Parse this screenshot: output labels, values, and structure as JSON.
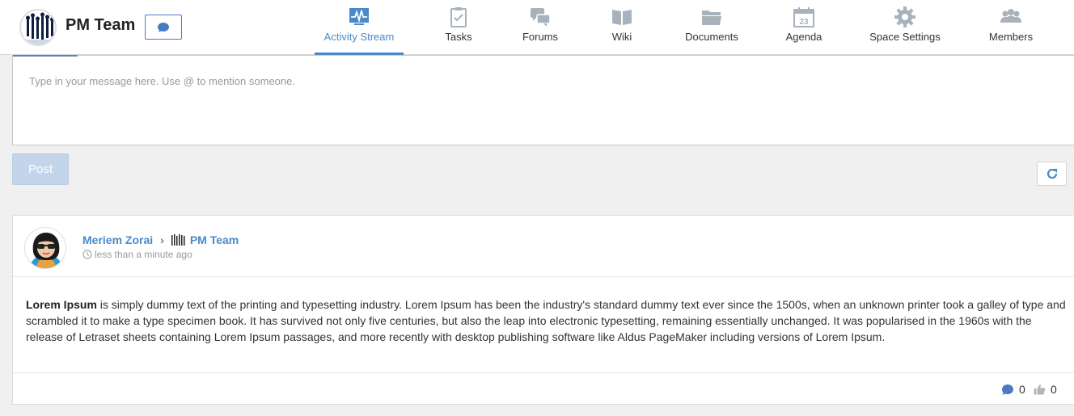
{
  "header": {
    "space_name": "PM Team",
    "nav": [
      {
        "label": "Activity Stream",
        "icon": "activity-stream-icon",
        "active": true
      },
      {
        "label": "Tasks",
        "icon": "tasks-icon"
      },
      {
        "label": "Forums",
        "icon": "forums-icon"
      },
      {
        "label": "Wiki",
        "icon": "wiki-icon"
      },
      {
        "label": "Documents",
        "icon": "documents-icon"
      },
      {
        "label": "Agenda",
        "icon": "agenda-icon",
        "day": "23"
      },
      {
        "label": "Space Settings",
        "icon": "gear-icon"
      },
      {
        "label": "Members",
        "icon": "members-icon"
      }
    ]
  },
  "composer": {
    "placeholder": "Type in your message here. Use @ to mention someone.",
    "post_label": "Post"
  },
  "activity": {
    "author": "Meriem Zorai",
    "space": "PM Team",
    "time": "less than a minute ago",
    "body_bold": "Lorem Ipsum",
    "body_text": " is simply dummy text of the printing and typesetting industry. Lorem Ipsum has been the industry's standard dummy text ever since the 1500s, when an unknown printer took a galley of type and scrambled it to make a type specimen book. It has survived not only five centuries, but also the leap into electronic typesetting, remaining essentially unchanged. It was popularised in the 1960s with the release of Letraset sheets containing Lorem Ipsum passages, and more recently with desktop publishing software like Aldus PageMaker including versions of Lorem Ipsum.",
    "comments": "0",
    "likes": "0"
  },
  "colors": {
    "accent": "#4a89c8",
    "icon_gray": "#a8b2bc",
    "post_disabled": "#c3d5ea"
  }
}
